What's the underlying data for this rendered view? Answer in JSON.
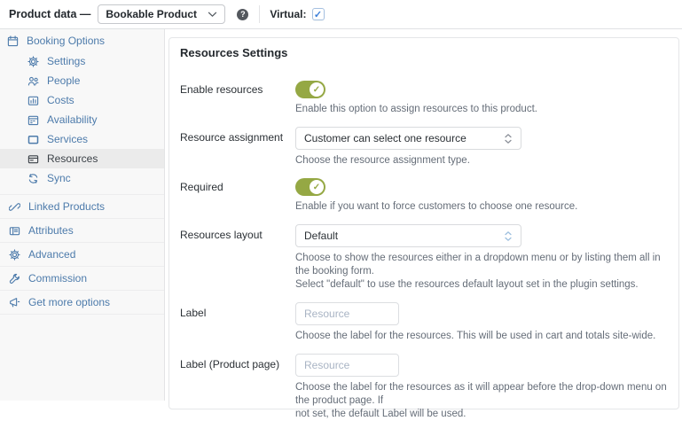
{
  "glyphs": {
    "check": "✓",
    "question": "?"
  },
  "colors": {
    "accent_blue": "#4d7bab",
    "toggle_green": "#95a844",
    "active_item_bg": "#ebebeb",
    "card_border": "#e5e6e8",
    "description_text": "#656d78",
    "checkbox_blue": "#3b7fd9"
  },
  "topbar": {
    "title": "Product data —",
    "product_type": "Bookable Product",
    "virtual_label": "Virtual:",
    "virtual_checked": "checked"
  },
  "sidebar": {
    "booking_group": {
      "label": "Booking Options",
      "items": [
        {
          "label": "Settings"
        },
        {
          "label": "People"
        },
        {
          "label": "Costs"
        },
        {
          "label": "Availability"
        },
        {
          "label": "Services"
        },
        {
          "label": "Resources"
        },
        {
          "label": "Sync"
        }
      ]
    },
    "items": [
      {
        "label": "Linked Products"
      },
      {
        "label": "Attributes"
      },
      {
        "label": "Advanced"
      },
      {
        "label": "Commission"
      },
      {
        "label": "Get more options"
      }
    ]
  },
  "panel": {
    "heading": "Resources Settings",
    "fields": [
      {
        "label": "Enable resources",
        "type": "toggle",
        "value": "on",
        "description": "Enable this option to assign resources to this product."
      },
      {
        "label": "Resource assignment",
        "type": "select",
        "value": "Customer can select one resource",
        "description": "Choose the resource assignment type."
      },
      {
        "label": "Required",
        "type": "toggle",
        "value": "on",
        "description": "Enable if you want to force customers to choose one resource."
      },
      {
        "label": "Resources layout",
        "type": "select",
        "value": "Default",
        "description": "Choose to show the resources either in a dropdown menu or by listing them all in the booking form.\nSelect \"default\" to use the resources default layout set in the plugin settings."
      },
      {
        "label": "Label",
        "type": "text",
        "placeholder": "Resource",
        "description": "Choose the label for the resources. This will be used in cart and totals site-wide."
      },
      {
        "label": "Label (Product page)",
        "type": "text",
        "placeholder": "Resource",
        "description": "Choose the label for the resources as it will appear before the drop-down menu on the product page. If\nnot set, the default Label will be used."
      }
    ]
  }
}
